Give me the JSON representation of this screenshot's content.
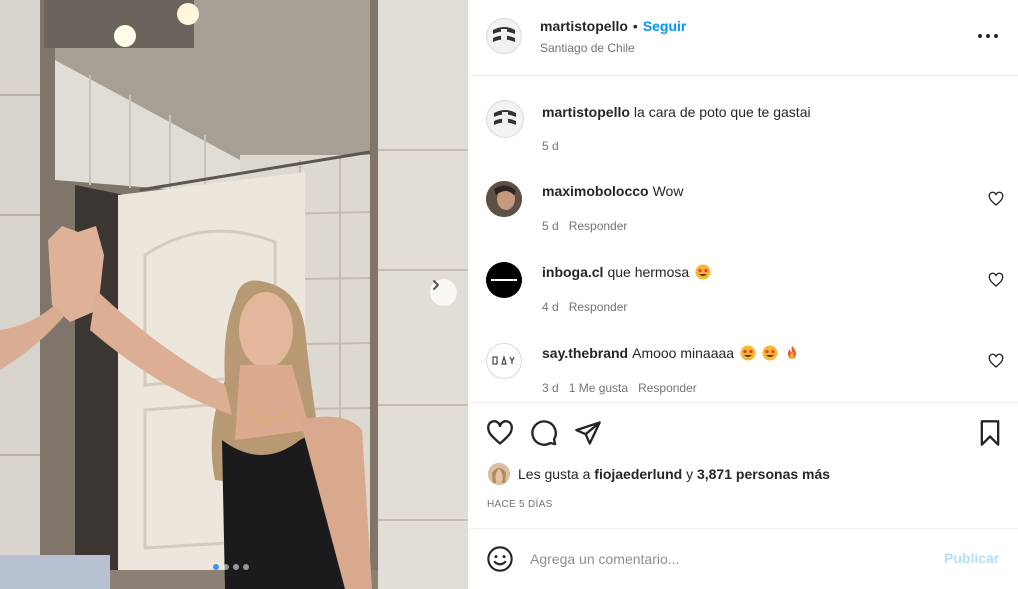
{
  "post": {
    "author": "martistopello",
    "follow_label": "Seguir",
    "location": "Santiago de Chile",
    "caption": {
      "username": "martistopello",
      "text": "la cara de poto que te gastai",
      "time": "5 d"
    },
    "carousel": {
      "current": 1,
      "total": 4
    }
  },
  "comments": [
    {
      "username": "maximobolocco",
      "text": "Wow",
      "emojis": [],
      "time": "5 d",
      "likes_label": "",
      "reply_label": "Responder"
    },
    {
      "username": "inboga.cl",
      "text": "que hermosa",
      "emojis": [
        "star-struck-emoji"
      ],
      "time": "4 d",
      "likes_label": "",
      "reply_label": "Responder"
    },
    {
      "username": "say.thebrand",
      "text": "Amooo minaaaa",
      "emojis": [
        "star-struck-emoji",
        "star-struck-emoji",
        "fire-emoji"
      ],
      "time": "3 d",
      "likes_label": "1 Me gusta",
      "reply_label": "Responder"
    }
  ],
  "likes": {
    "prefix": "Les gusta a",
    "user": "fiojaederlund",
    "middle": "y",
    "others": "3,871 personas más"
  },
  "date_label": "HACE 5 DÍAS",
  "composer": {
    "placeholder": "Agrega un comentario...",
    "publish_label": "Publicar"
  },
  "icons": {
    "like": "heart-icon",
    "comment": "comment-bubble-icon",
    "share": "paper-plane-icon",
    "save": "bookmark-icon",
    "more": "more-options-icon",
    "next": "chevron-right-icon",
    "emoji": "emoji-smile-icon"
  },
  "colors": {
    "link_blue": "#0095f6",
    "publish_disabled": "#b2dffc",
    "muted_text": "#737373",
    "active_dot": "#3b97f0"
  }
}
